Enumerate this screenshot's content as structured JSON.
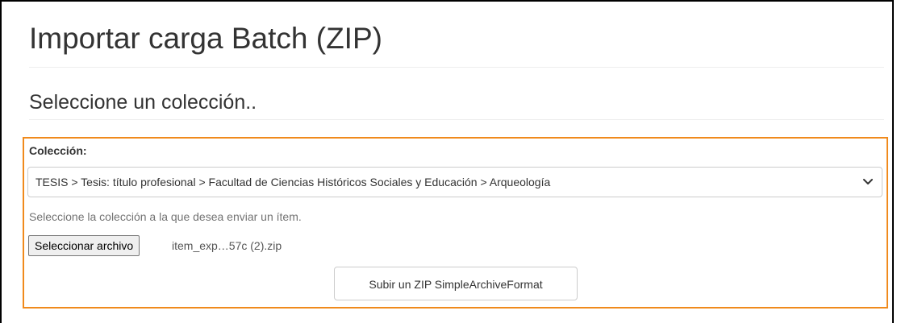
{
  "header": {
    "title": "Importar carga Batch (ZIP)"
  },
  "section": {
    "title": "Seleccione un colección.."
  },
  "form": {
    "collection_label": "Colección:",
    "collection_selected": "TESIS > Tesis: título profesional > Facultad de Ciencias Históricos Sociales y Educación > Arqueología",
    "collection_help": "Seleccione la colección a la que desea enviar un ítem.",
    "file_button_label": "Seleccionar archivo",
    "file_name": "item_exp…57c (2).zip",
    "submit_label": "Subir un ZIP SimpleArchiveFormat"
  },
  "icons": {
    "select_arrow": "chevron-down-icon"
  },
  "colors": {
    "highlight": "#f08a1c",
    "text": "#333333",
    "help_text": "#737373"
  }
}
